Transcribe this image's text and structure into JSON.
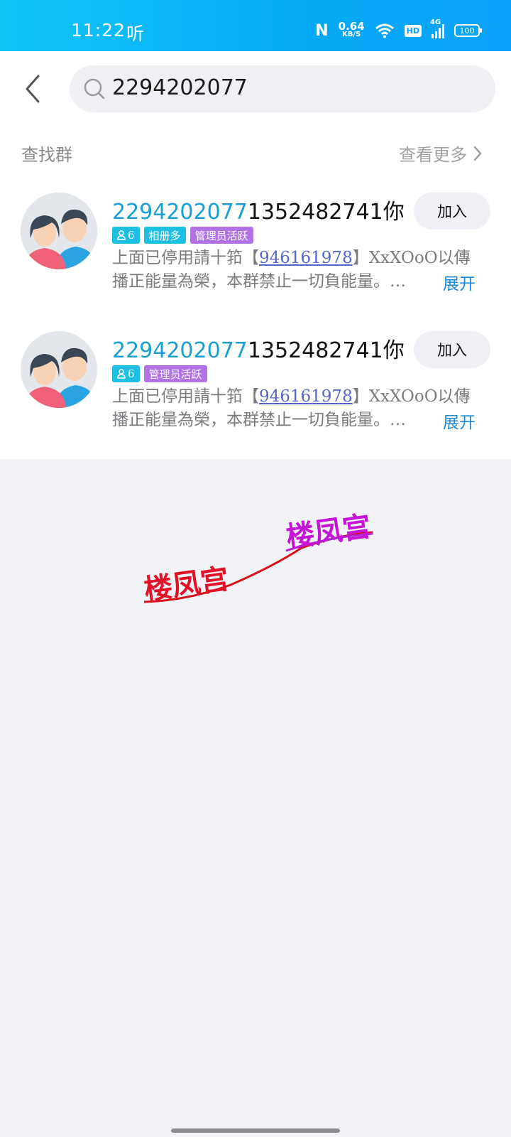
{
  "status_bar": {
    "time": "11:22",
    "listen_glyph": "听",
    "nfc": "N",
    "net_speed_value": "0.64",
    "net_speed_unit": "KB/S",
    "hd": "HD",
    "network": "4G",
    "battery": "100"
  },
  "search": {
    "query": "2294202077"
  },
  "section": {
    "title": "查找群",
    "see_more": "查看更多"
  },
  "groups": [
    {
      "name_highlight": "2294202077",
      "name_rest": "1352482741你",
      "member_count": "6",
      "tags": [
        "相册多",
        "管理员活跃"
      ],
      "desc_line1_before": "上面已停用請十筘【",
      "desc_link": "946161978",
      "desc_line1_after": "】XxXOoO以傳",
      "desc_line2": "播正能量為榮，本群禁止一切負能量。…",
      "expand": "展开",
      "join": "加入"
    },
    {
      "name_highlight": "2294202077",
      "name_rest": "1352482741你",
      "member_count": "6",
      "tags": [
        "管理员活跃"
      ],
      "desc_line1_before": "上面已停用請十筘【",
      "desc_link": "946161978",
      "desc_line1_after": "】XxXOoO以傳",
      "desc_line2": "播正能量為榮，本群禁止一切負能量。…",
      "expand": "展开",
      "join": "加入"
    }
  ],
  "watermark": {
    "text_left": "楼凤宫",
    "text_right": "楼凤宫"
  },
  "colors": {
    "accent": "#1a9fd3",
    "link": "#5466c9",
    "tag_blue": "#1ebfe3",
    "tag_purple": "#b072e4"
  }
}
